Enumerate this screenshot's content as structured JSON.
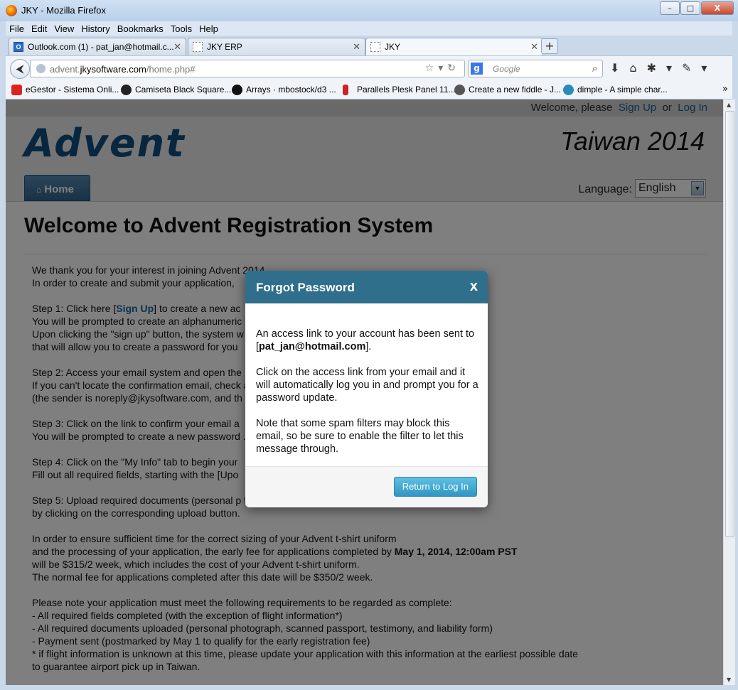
{
  "window": {
    "title": "JKY - Mozilla Firefox",
    "controls": [
      "–",
      "□",
      "X"
    ]
  },
  "menu": [
    "File",
    "Edit",
    "View",
    "History",
    "Bookmarks",
    "Tools",
    "Help"
  ],
  "tabs": [
    {
      "label": "Outlook.com (1) - pat_jan@hotmail.c...",
      "icon": "O"
    },
    {
      "label": "JKY ERP"
    },
    {
      "label": "JKY",
      "active": true
    }
  ],
  "address": {
    "prefix": "advent.",
    "domain": "jkysoftware.com",
    "path": "/home.php#"
  },
  "search": {
    "placeholder": "Google",
    "engine": "g"
  },
  "bookmarks": [
    {
      "label": "eGestor - Sistema Onli...",
      "color": "#d22"
    },
    {
      "label": "Camiseta Black Square...",
      "color": "#222"
    },
    {
      "label": "Arrays · mbostock/d3 ...",
      "color": "#111"
    },
    {
      "label": "Parallels Plesk Panel 11...",
      "color": "#c22"
    },
    {
      "label": "Create a new fiddle - J...",
      "color": "#555"
    },
    {
      "label": "dimple - A simple char...",
      "color": "#2a8ab8"
    }
  ],
  "site": {
    "welcome_prefix": "Welcome, please",
    "sign_up": "Sign Up",
    "or": "or",
    "log_in": "Log In",
    "logo": "Advent",
    "event": "Taiwan 2014",
    "home_tab": "Home",
    "language_label": "Language:",
    "language_value": "English",
    "heading": "Welcome to Advent Registration System"
  },
  "paragraphs": [
    [
      "We thank you for your interest in joining Advent 2014",
      "In order to create and submit your application,"
    ],
    [
      "Step 1: Click here [|Sign Up|] to create a new ac",
      "You will be prompted to create an alphanumeric",
      "Upon clicking the \"sign up\" button, the system w",
      "that will allow you to create a password for you"
    ],
    [
      "Step 2: Access your email system and open the",
      "If you can't locate the confirmation email, check                                                              as spam",
      "(the sender is noreply@jkysoftware.com, and th"
    ],
    [
      "Step 3: Click on the link to confirm your email a",
      "You will be prompted to create a new password                                                                  ."
    ],
    [
      "Step 4: Click on the \"My Info\" tab to begin your",
      "Fill out all required fields, starting with the [Upo"
    ],
    [
      "Step 5: Upload required documents (personal p                                                               form)",
      "by clicking on the corresponding upload button."
    ],
    [
      "In order to ensure sufficient time for the correct sizing of your Advent t-shirt uniform",
      "and the processing of your application, the early fee for applications completed by |**May 1, 2014, 12:00am PST|",
      "will be $315/2 week, which includes the cost of your Advent t-shirt uniform.",
      "The normal fee for applications completed after this date will be $350/2 week."
    ],
    [
      "Please note your application must meet the following requirements to be regarded as complete:",
      "- All required fields completed (with the exception of flight information*)",
      "- All required documents uploaded (personal photograph, scanned passport, testimony, and liability form)",
      "- Payment sent (postmarked by May 1 to qualify for the early registration fee)",
      "* if flight information is unknown at this time, please update your application with this information at the earliest possible date",
      "to guarantee airport pick up in Taiwan."
    ]
  ],
  "modal": {
    "title": "Forgot Password",
    "close": "x",
    "p1_a": "An access link to your account has been sent to [",
    "p1_email": "pat_jan@hotmail.com",
    "p1_b": "].",
    "p2": "Click on the access link from your email and it will automatically log you in and prompt you for a password update.",
    "p3": "Note that some spam filters may block this email, so be sure to enable the filter to let this message through.",
    "button": "Return to Log In"
  }
}
